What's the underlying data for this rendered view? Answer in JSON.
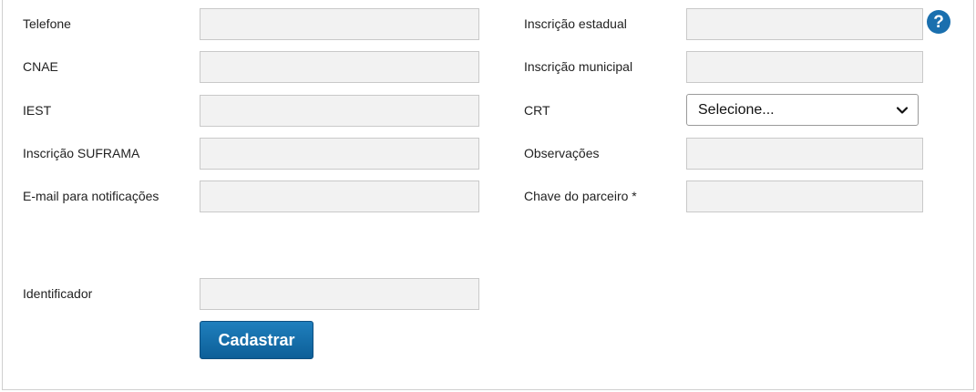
{
  "form": {
    "left": [
      {
        "label": "Telefone",
        "value": ""
      },
      {
        "label": "CNAE",
        "value": ""
      },
      {
        "label": "IEST",
        "value": ""
      },
      {
        "label": "Inscrição SUFRAMA",
        "value": ""
      },
      {
        "label": "E-mail para notificações",
        "value": ""
      }
    ],
    "right": [
      {
        "label": "Inscrição estadual",
        "value": ""
      },
      {
        "label": "Inscrição municipal",
        "value": ""
      },
      {
        "label": "CRT",
        "selected": "Selecione..."
      },
      {
        "label": "Observações",
        "value": ""
      },
      {
        "label": "Chave do parceiro *",
        "value": ""
      }
    ],
    "identificador": {
      "label": "Identificador",
      "value": ""
    },
    "help_icon": "question-circle-icon",
    "submit_label": "Cadastrar"
  },
  "colors": {
    "input_bg": "#f2f2f2",
    "input_border": "#c9c9c9",
    "button": "#1b73b2",
    "help_icon": "#1a6fae"
  }
}
